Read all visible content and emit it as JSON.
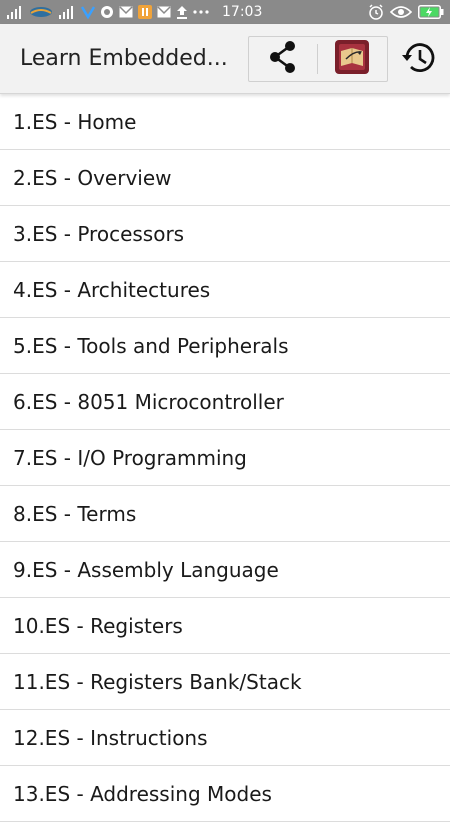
{
  "status_bar": {
    "time": "17:03",
    "icons": [
      "signal-icon",
      "carrier-icon",
      "signal-icon",
      "notification-icon",
      "vpn-icon",
      "mail-icon",
      "app-icon",
      "upload-icon",
      "more-dots-icon",
      "alarm-icon",
      "eye-icon",
      "battery-charging-icon"
    ],
    "background": "#8a8a8a"
  },
  "toolbar": {
    "title": "Learn Embedded...",
    "share_icon": "share-icon",
    "book_icon": "book-icon",
    "history_icon": "history-icon"
  },
  "items": [
    {
      "label": "1.ES - Home"
    },
    {
      "label": "2.ES - Overview"
    },
    {
      "label": "3.ES - Processors"
    },
    {
      "label": "4.ES - Architectures"
    },
    {
      "label": "5.ES - Tools and Peripherals"
    },
    {
      "label": "6.ES - 8051 Microcontroller"
    },
    {
      "label": "7.ES - I/O Programming"
    },
    {
      "label": "8.ES - Terms"
    },
    {
      "label": "9.ES - Assembly Language"
    },
    {
      "label": "10.ES - Registers"
    },
    {
      "label": "11.ES - Registers Bank/Stack"
    },
    {
      "label": "12.ES - Instructions"
    },
    {
      "label": "13.ES - Addressing Modes"
    }
  ]
}
